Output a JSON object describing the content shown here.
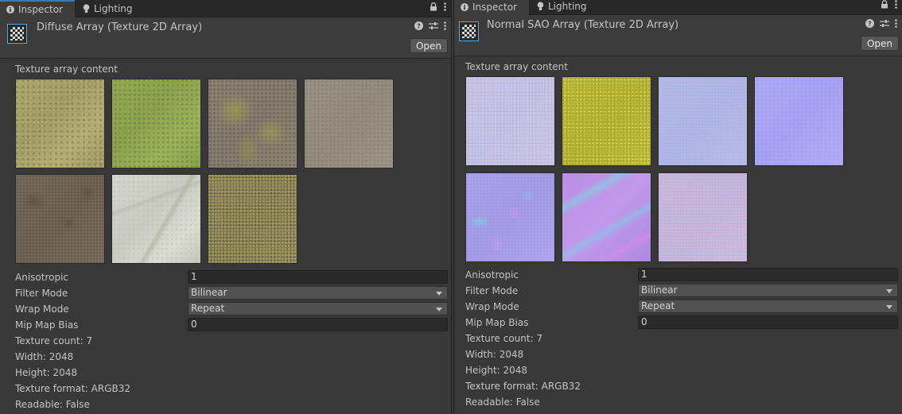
{
  "tabs": {
    "inspector": "Inspector",
    "lighting": "Lighting"
  },
  "buttons": {
    "open": "Open"
  },
  "left": {
    "title": "Diffuse Array (Texture 2D Array)",
    "section_label": "Texture array content",
    "fields": {
      "anisotropic_label": "Anisotropic",
      "anisotropic_value": "1",
      "filter_label": "Filter Mode",
      "filter_value": "Bilinear",
      "wrap_label": "Wrap Mode",
      "wrap_value": "Repeat",
      "mip_label": "Mip Map Bias",
      "mip_value": "0"
    },
    "info": {
      "count": "Texture count: 7",
      "width": "Width: 2048",
      "height": "Height: 2048",
      "format": "Texture format: ARGB32",
      "readable": "Readable: False"
    }
  },
  "right": {
    "title": "Normal SAO Array (Texture 2D Array)",
    "section_label": "Texture array content",
    "fields": {
      "anisotropic_label": "Anisotropic",
      "anisotropic_value": "1",
      "filter_label": "Filter Mode",
      "filter_value": "Bilinear",
      "wrap_label": "Wrap Mode",
      "wrap_value": "Repeat",
      "mip_label": "Mip Map Bias",
      "mip_value": "0"
    },
    "info": {
      "count": "Texture count: 7",
      "width": "Width: 2048",
      "height": "Height: 2048",
      "format": "Texture format: ARGB32",
      "readable": "Readable: False"
    }
  },
  "colors": {
    "accent": "#3a79bb",
    "panel_bg": "#383838",
    "icon_border": "#57a8d7"
  },
  "icons": [
    "info-icon",
    "lightbulb-icon",
    "lock-icon",
    "more-icon",
    "help-icon",
    "settings-sliders-icon",
    "texture-array-icon",
    "dropdown-caret-icon"
  ]
}
